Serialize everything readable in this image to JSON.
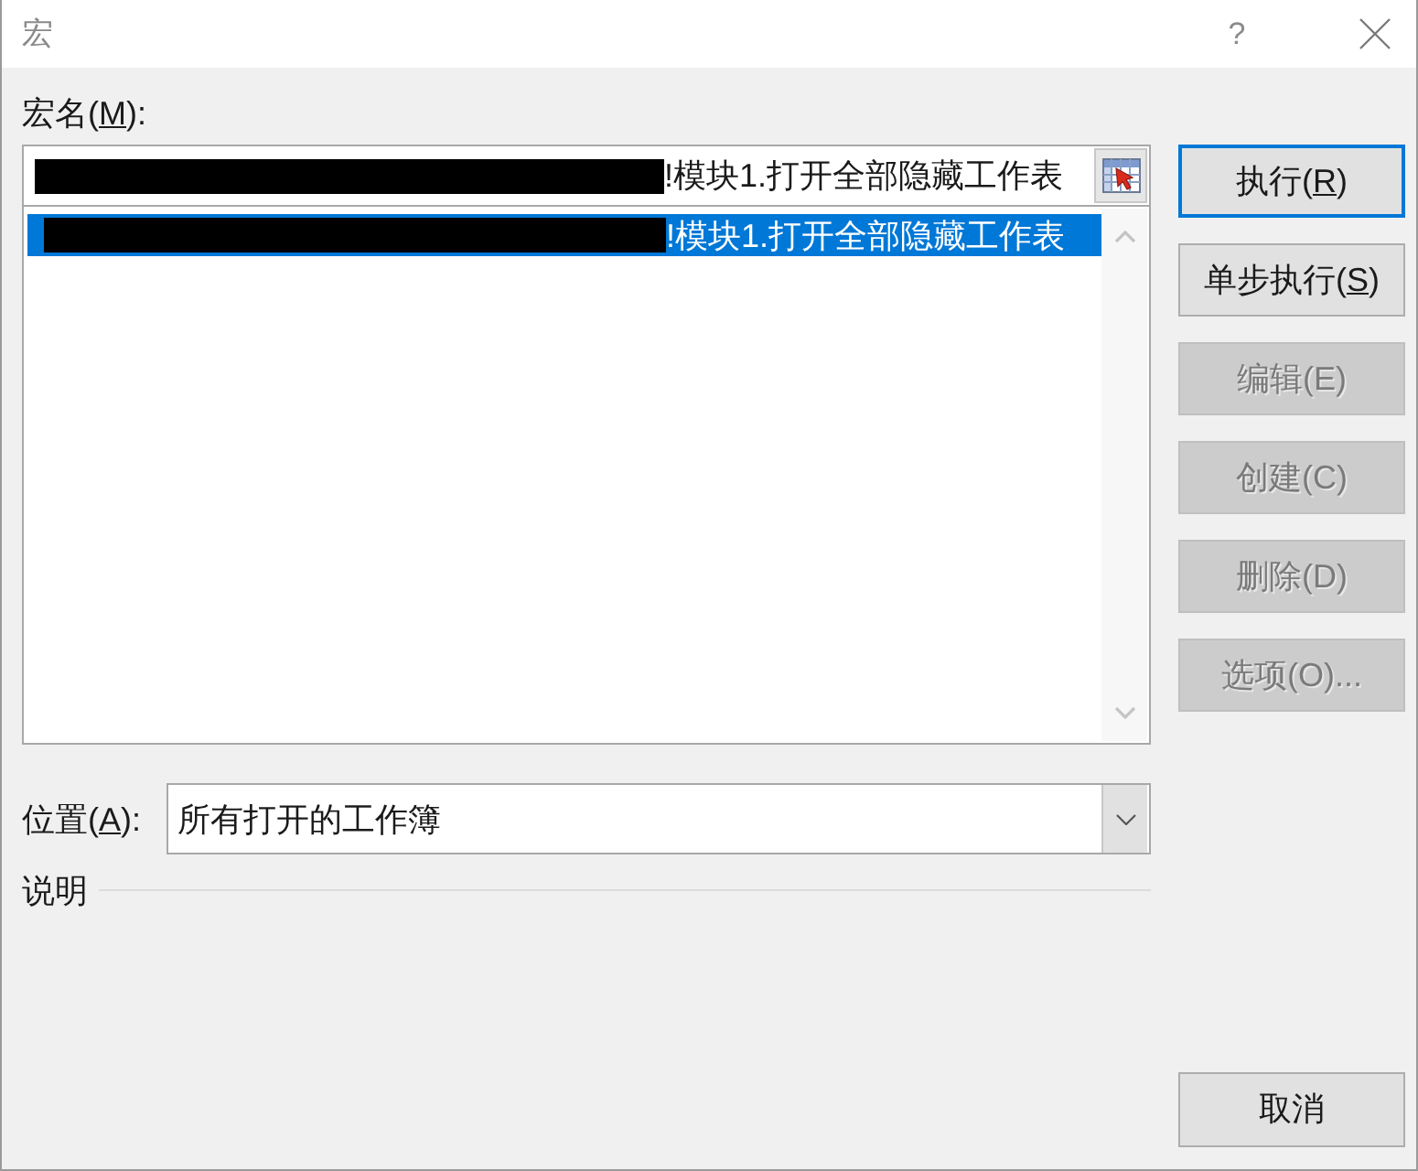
{
  "window": {
    "title": "宏",
    "help": "?"
  },
  "macro_name": {
    "label": {
      "text": "宏名(",
      "key": "M",
      "after": "):"
    },
    "value": "!模块1.打开全部隐藏工作表",
    "redacted": true
  },
  "macro_list": {
    "items": [
      {
        "text": "!模块1.打开全部隐藏工作表",
        "selected": true,
        "redacted": true
      }
    ]
  },
  "buttons": [
    {
      "label": "执行(",
      "key": "R",
      "after": ")",
      "disabled": false,
      "default": true
    },
    {
      "label": "单步执行(",
      "key": "S",
      "after": ")",
      "disabled": false,
      "default": false
    },
    {
      "label": "编辑(E)",
      "disabled": true,
      "default": false
    },
    {
      "label": "创建(C)",
      "disabled": true,
      "default": false
    },
    {
      "label": "删除(D)",
      "disabled": true,
      "default": false
    },
    {
      "label": "选项(O)...",
      "disabled": true,
      "default": false
    }
  ],
  "location": {
    "label": {
      "text": "位置(",
      "key": "A",
      "after": "):"
    },
    "value": "所有打开的工作簿"
  },
  "description": {
    "label": "说明"
  },
  "cancel_button": {
    "label": "取消"
  }
}
